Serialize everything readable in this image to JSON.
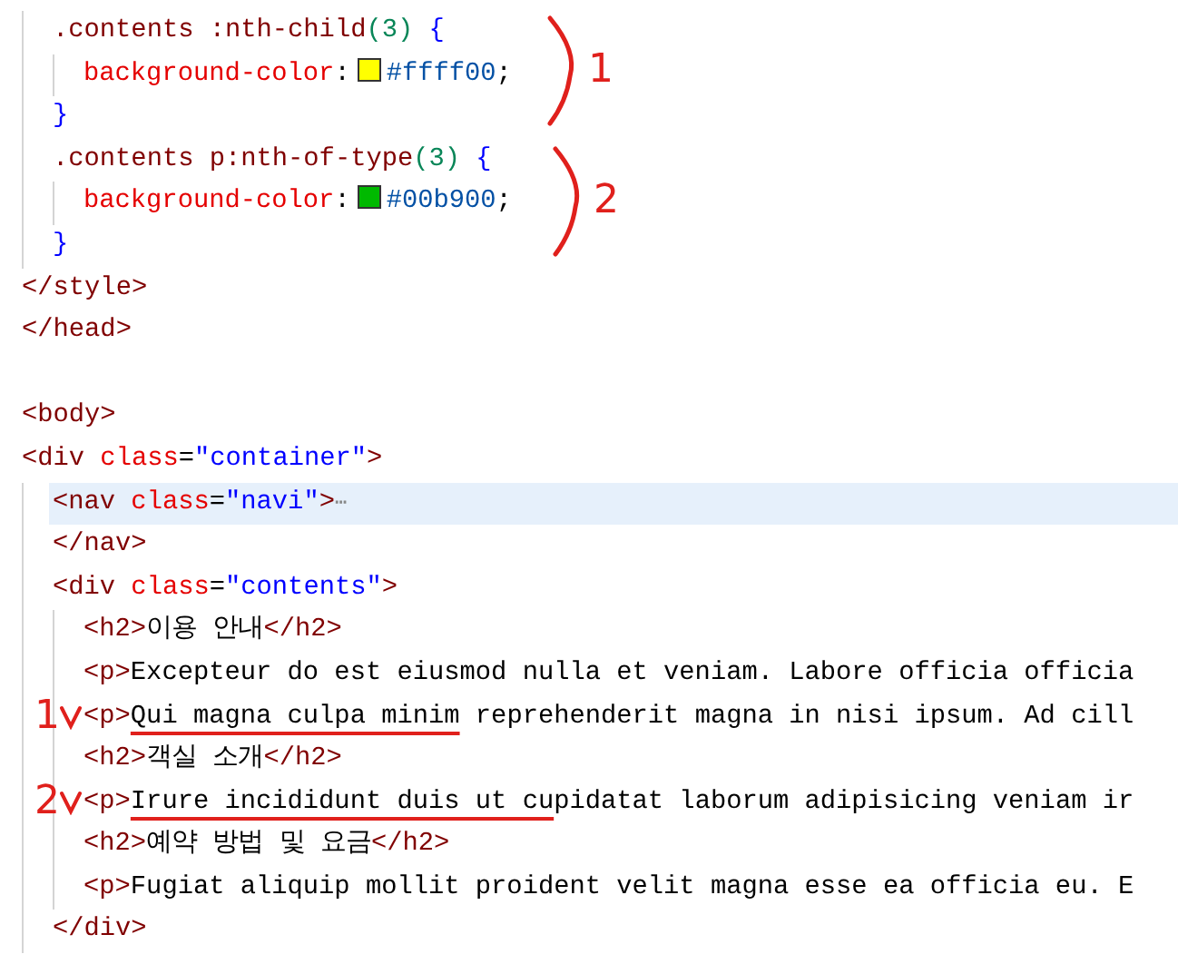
{
  "editor": {
    "lines": [
      {
        "kind": "group",
        "children": [
          {
            "kind": "code",
            "current": false,
            "tokens": [
              {
                "kind": "selector",
                "text": ".contents :nth-child"
              },
              {
                "kind": "number",
                "text": "(3)"
              },
              {
                "kind": "brace",
                "text": " {"
              }
            ],
            "children": [
              {
                "kind": "code",
                "current": false,
                "tokens": [
                  {
                    "kind": "property",
                    "text": "background-color"
                  },
                  {
                    "kind": "plain",
                    "text": ":"
                  },
                  {
                    "kind": "swatch",
                    "color": "#ffff00"
                  },
                  {
                    "kind": "value",
                    "text": "#ffff00"
                  },
                  {
                    "kind": "plain",
                    "text": ";"
                  }
                ]
              }
            ]
          },
          {
            "kind": "code",
            "current": false,
            "tokens": [
              {
                "kind": "brace",
                "text": "}"
              }
            ]
          },
          {
            "kind": "code",
            "current": false,
            "tokens": [
              {
                "kind": "selector",
                "text": ".contents p:nth-of-type"
              },
              {
                "kind": "number",
                "text": "(3)"
              },
              {
                "kind": "brace",
                "text": " {"
              }
            ],
            "children": [
              {
                "kind": "code",
                "current": false,
                "tokens": [
                  {
                    "kind": "property",
                    "text": "background-color"
                  },
                  {
                    "kind": "plain",
                    "text": ":"
                  },
                  {
                    "kind": "swatch",
                    "color": "#00b900"
                  },
                  {
                    "kind": "value",
                    "text": "#00b900"
                  },
                  {
                    "kind": "plain",
                    "text": ";"
                  }
                ]
              }
            ]
          },
          {
            "kind": "code",
            "current": false,
            "tokens": [
              {
                "kind": "brace",
                "text": "}"
              }
            ]
          }
        ]
      },
      {
        "kind": "code",
        "current": false,
        "tokens": [
          {
            "kind": "tag",
            "text": "</style>"
          }
        ]
      },
      {
        "kind": "code",
        "current": false,
        "tokens": [
          {
            "kind": "tag",
            "text": "</head>"
          }
        ]
      },
      {
        "kind": "blank"
      },
      {
        "kind": "code",
        "current": false,
        "tokens": [
          {
            "kind": "tag",
            "text": "<body>"
          }
        ]
      },
      {
        "kind": "code",
        "current": false,
        "tokens": [
          {
            "kind": "tag",
            "text": "<div"
          },
          {
            "kind": "attr",
            "text": " class"
          },
          {
            "kind": "plain",
            "text": "="
          },
          {
            "kind": "string",
            "text": "\"container\""
          },
          {
            "kind": "tag",
            "text": ">"
          }
        ],
        "children": [
          {
            "kind": "code",
            "current": true,
            "tokens": [
              {
                "kind": "tag",
                "text": "<nav"
              },
              {
                "kind": "attr",
                "text": " class"
              },
              {
                "kind": "plain",
                "text": "="
              },
              {
                "kind": "string",
                "text": "\"navi\""
              },
              {
                "kind": "tag",
                "text": ">"
              },
              {
                "kind": "fold",
                "text": "⋯"
              }
            ]
          },
          {
            "kind": "code",
            "current": false,
            "tokens": [
              {
                "kind": "tag",
                "text": "</nav>"
              }
            ]
          },
          {
            "kind": "code",
            "current": false,
            "tokens": [
              {
                "kind": "tag",
                "text": "<div"
              },
              {
                "kind": "attr",
                "text": " class"
              },
              {
                "kind": "plain",
                "text": "="
              },
              {
                "kind": "string",
                "text": "\"contents\""
              },
              {
                "kind": "tag",
                "text": ">"
              }
            ],
            "children": [
              {
                "kind": "code",
                "current": false,
                "tokens": [
                  {
                    "kind": "tag",
                    "text": "<h2>"
                  },
                  {
                    "kind": "plain",
                    "text": "이용 안내"
                  },
                  {
                    "kind": "tag",
                    "text": "</h2>"
                  }
                ]
              },
              {
                "kind": "code",
                "current": false,
                "tokens": [
                  {
                    "kind": "tag",
                    "text": "<p>"
                  },
                  {
                    "kind": "plain",
                    "text": "Excepteur do est eiusmod nulla et veniam. Labore officia officia"
                  }
                ]
              },
              {
                "kind": "code",
                "current": false,
                "mark": {
                  "label": "1"
                },
                "tokens": [
                  {
                    "kind": "tag",
                    "text": "<p>"
                  },
                  {
                    "kind": "underlined",
                    "text": "Qui magna culpa minim"
                  },
                  {
                    "kind": "plain",
                    "text": " reprehenderit magna in nisi ipsum. Ad cill"
                  }
                ]
              },
              {
                "kind": "code",
                "current": false,
                "tokens": [
                  {
                    "kind": "tag",
                    "text": "<h2>"
                  },
                  {
                    "kind": "plain",
                    "text": "객실 소개"
                  },
                  {
                    "kind": "tag",
                    "text": "</h2>"
                  }
                ]
              },
              {
                "kind": "code",
                "current": false,
                "mark": {
                  "label": "2"
                },
                "tokens": [
                  {
                    "kind": "tag",
                    "text": "<p>"
                  },
                  {
                    "kind": "underlined",
                    "text": "Irure incididunt duis ut cu"
                  },
                  {
                    "kind": "plain",
                    "text": "pidatat laborum adipisicing veniam ir"
                  }
                ]
              },
              {
                "kind": "code",
                "current": false,
                "tokens": [
                  {
                    "kind": "tag",
                    "text": "<h2>"
                  },
                  {
                    "kind": "plain",
                    "text": "예약 방법 및 요금"
                  },
                  {
                    "kind": "tag",
                    "text": "</h2>"
                  }
                ]
              },
              {
                "kind": "code",
                "current": false,
                "tokens": [
                  {
                    "kind": "tag",
                    "text": "<p>"
                  },
                  {
                    "kind": "plain",
                    "text": "Fugiat aliquip mollit proident velit magna esse ea officia eu. E"
                  }
                ]
              }
            ]
          },
          {
            "kind": "code",
            "current": false,
            "tokens": [
              {
                "kind": "tag",
                "text": "</div>"
              }
            ]
          }
        ]
      }
    ]
  },
  "annotations": [
    {
      "kind": "bracket",
      "label": "1"
    },
    {
      "kind": "bracket",
      "label": "2"
    }
  ]
}
